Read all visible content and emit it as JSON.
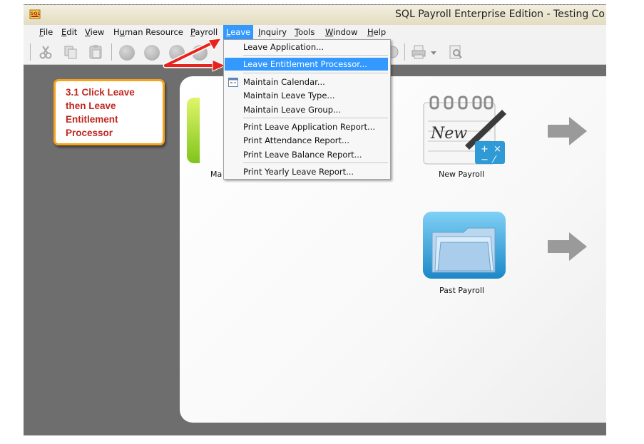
{
  "window": {
    "title": "SQL Payroll Enterprise Edition - Testing Co",
    "app_icon": "sql-payroll-icon"
  },
  "menubar": {
    "items": [
      {
        "label": "File",
        "active": false
      },
      {
        "label": "Edit",
        "active": false
      },
      {
        "label": "View",
        "active": false
      },
      {
        "label": "Human Resource",
        "active": false
      },
      {
        "label": "Payroll",
        "active": false
      },
      {
        "label": "Leave",
        "active": true
      },
      {
        "label": "Inquiry",
        "active": false
      },
      {
        "label": "Tools",
        "active": false
      },
      {
        "label": "Window",
        "active": false
      },
      {
        "label": "Help",
        "active": false
      }
    ]
  },
  "leave_menu": {
    "items": [
      {
        "label": "Leave Application...",
        "highlighted": false
      },
      {
        "label": "Leave Entitlement Processor...",
        "highlighted": true
      },
      {
        "label": "Maintain Calendar...",
        "highlighted": false,
        "icon": "calendar-icon"
      },
      {
        "label": "Maintain Leave Type...",
        "highlighted": false
      },
      {
        "label": "Maintain Leave Group...",
        "highlighted": false
      },
      {
        "label": "Print Leave Application Report...",
        "highlighted": false
      },
      {
        "label": "Print Attendance Report...",
        "highlighted": false
      },
      {
        "label": "Print Leave Balance Report...",
        "highlighted": false
      },
      {
        "label": "Print Yearly Leave Report...",
        "highlighted": false
      }
    ]
  },
  "callout": {
    "lines": [
      "3.1 Click Leave",
      "then Leave",
      "Entitlement",
      "Processor"
    ],
    "text_color": "#c0271f",
    "border_color": "#f6a31b"
  },
  "tiles": [
    {
      "label": "Ma",
      "icon": "maintenance-icon"
    },
    {
      "label": "New Payroll",
      "icon": "new-payroll-notepad-icon"
    },
    {
      "label": "Past Payroll",
      "icon": "past-payroll-folder-icon"
    }
  ],
  "colors": {
    "menu_highlight": "#3399ff",
    "annotation_arrow": "#e8231c"
  }
}
